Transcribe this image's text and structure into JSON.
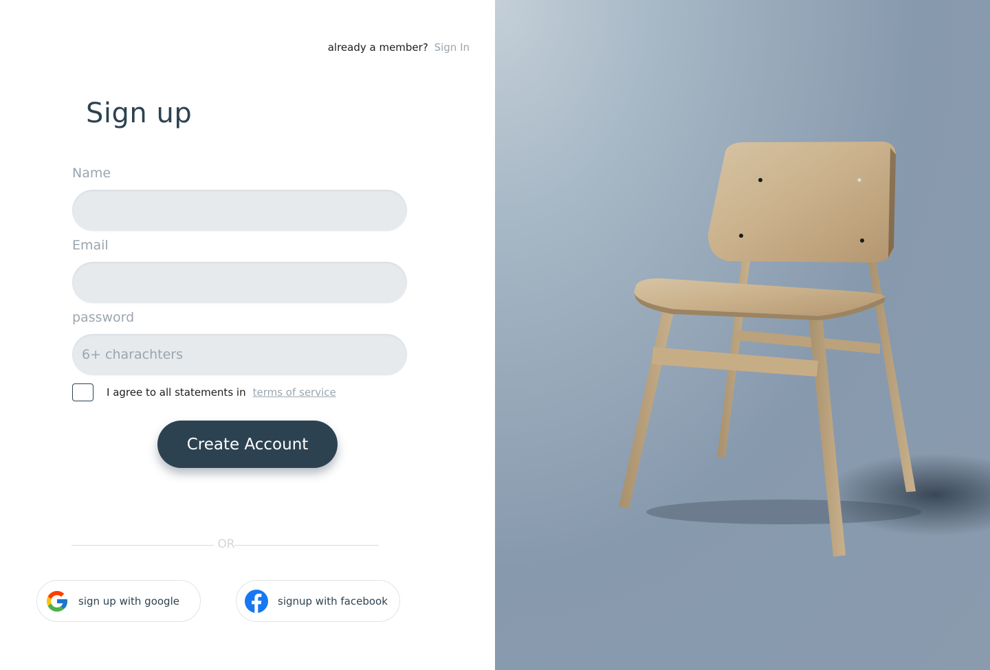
{
  "header": {
    "member_prompt": "already a member?",
    "signin_label": "Sign In"
  },
  "form": {
    "title": "Sign up",
    "name_label": "Name",
    "name_value": "",
    "email_label": "Email",
    "email_value": "",
    "password_label": "password",
    "password_placeholder": "6+ charachters",
    "agree_text": "I agree to all statements in",
    "terms_label": "terms of service",
    "agree_checked": false,
    "create_label": "Create Account"
  },
  "divider": {
    "text": "OR"
  },
  "social": {
    "google_label": "sign up with google",
    "google_icon": "google-icon",
    "facebook_label": "signup with facebook",
    "facebook_icon": "facebook-icon"
  },
  "colors": {
    "primary": "#2d4250",
    "muted": "#9aa5ae",
    "input_bg": "#e6eaed",
    "image_bg": "#8a9bae"
  }
}
